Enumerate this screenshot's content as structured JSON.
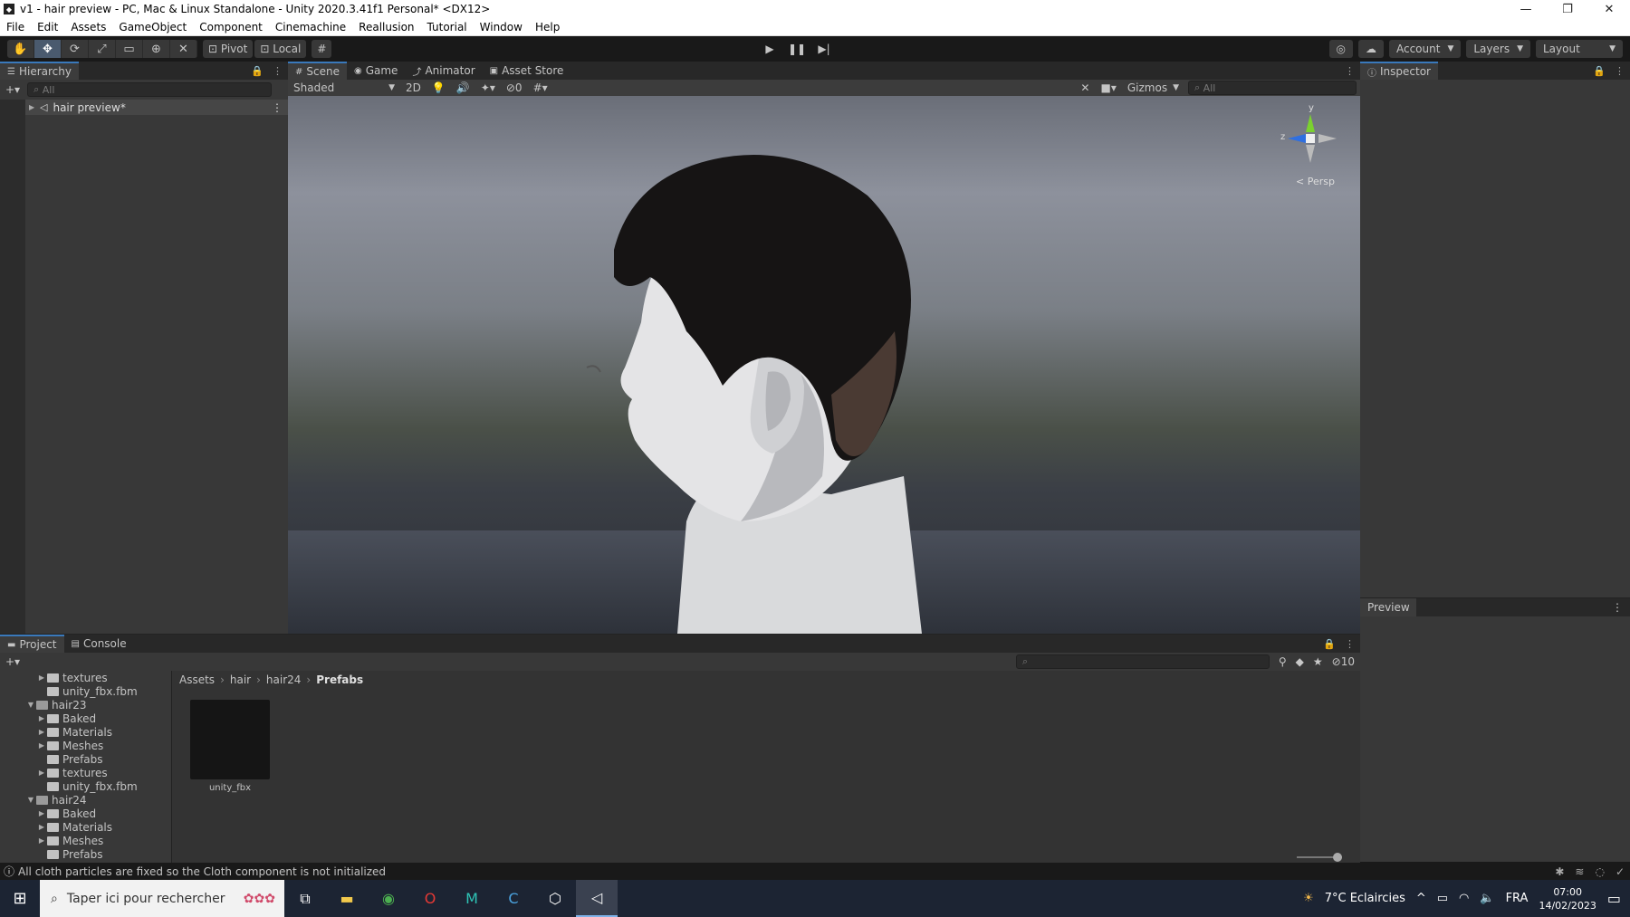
{
  "window": {
    "title": "v1 - hair preview - PC, Mac & Linux Standalone - Unity 2020.3.41f1 Personal* <DX12>",
    "minimize": "—",
    "restore": "❐",
    "close": "✕"
  },
  "menu": [
    "File",
    "Edit",
    "Assets",
    "GameObject",
    "Component",
    "Cinemachine",
    "Reallusion",
    "Tutorial",
    "Window",
    "Help"
  ],
  "toolbar": {
    "pivot": "Pivot",
    "local": "Local",
    "account": "Account",
    "layers": "Layers",
    "layout": "Layout"
  },
  "hierarchy": {
    "tab": "Hierarchy",
    "search_placeholder": "All",
    "scene_name": "hair preview*"
  },
  "scene": {
    "tabs": [
      "Scene",
      "Game",
      "Animator",
      "Asset Store"
    ],
    "shading": "Shaded",
    "mode_2d": "2D",
    "hidden_count": "0",
    "gizmos": "Gizmos",
    "search_placeholder": "All",
    "persp": "< Persp",
    "axis_y": "y",
    "axis_z": "z"
  },
  "inspector": {
    "tab": "Inspector"
  },
  "preview": {
    "tab": "Preview"
  },
  "project": {
    "tabs": [
      "Project",
      "Console"
    ],
    "hidden_count": "10",
    "tree": [
      {
        "label": "textures",
        "indent": 2,
        "arrow": "▶"
      },
      {
        "label": "unity_fbx.fbm",
        "indent": 2,
        "arrow": ""
      },
      {
        "label": "hair23",
        "indent": 1,
        "arrow": "▼"
      },
      {
        "label": "Baked",
        "indent": 2,
        "arrow": "▶"
      },
      {
        "label": "Materials",
        "indent": 2,
        "arrow": "▶"
      },
      {
        "label": "Meshes",
        "indent": 2,
        "arrow": "▶"
      },
      {
        "label": "Prefabs",
        "indent": 2,
        "arrow": ""
      },
      {
        "label": "textures",
        "indent": 2,
        "arrow": "▶"
      },
      {
        "label": "unity_fbx.fbm",
        "indent": 2,
        "arrow": ""
      },
      {
        "label": "hair24",
        "indent": 1,
        "arrow": "▼"
      },
      {
        "label": "Baked",
        "indent": 2,
        "arrow": "▶"
      },
      {
        "label": "Materials",
        "indent": 2,
        "arrow": "▶"
      },
      {
        "label": "Meshes",
        "indent": 2,
        "arrow": "▶"
      },
      {
        "label": "Prefabs",
        "indent": 2,
        "arrow": ""
      }
    ],
    "breadcrumb": [
      "Assets",
      "hair",
      "hair24",
      "Prefabs"
    ],
    "asset": "unity_fbx"
  },
  "status": {
    "message": "All cloth particles are fixed so the Cloth component is not initialized"
  },
  "taskbar": {
    "search_placeholder": "Taper ici pour rechercher",
    "weather": "7°C  Eclaircies",
    "lang": "FRA",
    "time": "07:00",
    "date": "14/02/2023"
  }
}
